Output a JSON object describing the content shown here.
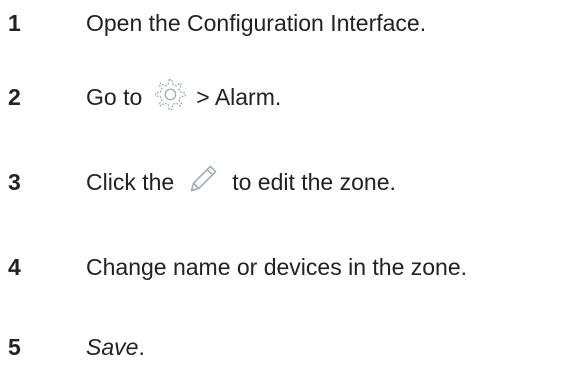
{
  "steps": [
    {
      "number": "1",
      "text": "Open the Configuration Interface."
    },
    {
      "number": "2",
      "text_before": "Go to",
      "icon": "gear-icon",
      "text_after": "> Alarm."
    },
    {
      "number": "3",
      "text_before": "Click the",
      "icon": "pencil-icon",
      "text_after": "to edit the zone."
    },
    {
      "number": "4",
      "text": "Change name or devices in the zone."
    },
    {
      "number": "5",
      "text_italic": "Save",
      "text_after": "."
    }
  ],
  "colors": {
    "text": "#222222",
    "icon": "#9aa9b8"
  }
}
